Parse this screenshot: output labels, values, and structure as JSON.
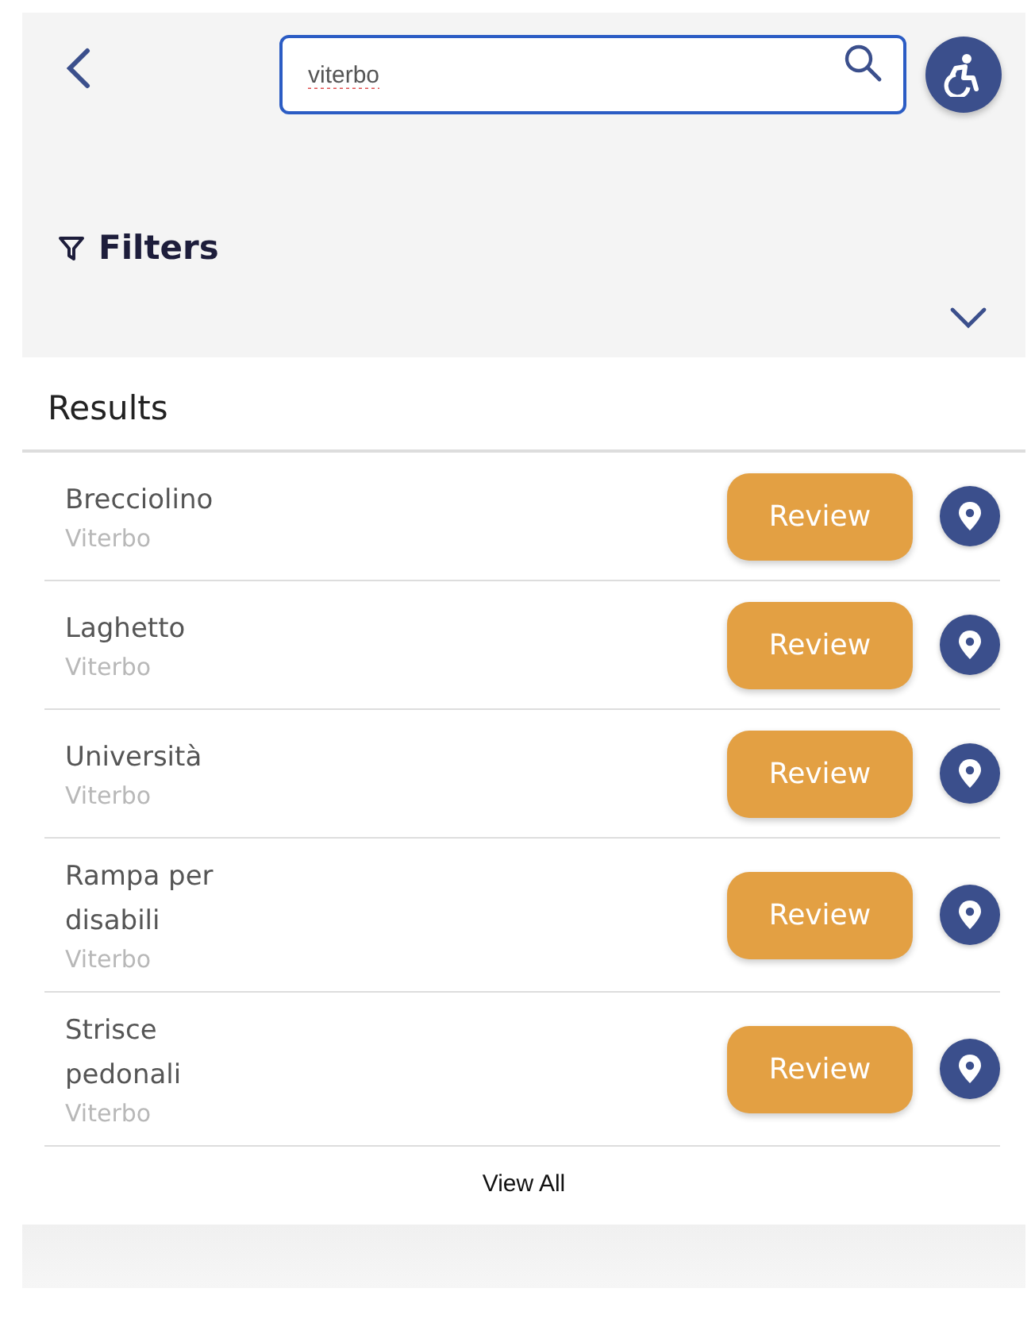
{
  "search": {
    "value": "viterbo"
  },
  "filters": {
    "label": "Filters",
    "expanded": false
  },
  "results": {
    "title": "Results",
    "items": [
      {
        "name": "Brecciolino",
        "city": "Viterbo",
        "button": "Review"
      },
      {
        "name": "Laghetto",
        "city": "Viterbo",
        "button": "Review"
      },
      {
        "name": "Università",
        "city": "Viterbo",
        "button": "Review"
      },
      {
        "name": "Rampa per disabili",
        "city": "Viterbo",
        "button": "Review"
      },
      {
        "name": "Strisce pedonali",
        "city": "Viterbo",
        "button": "Review"
      }
    ],
    "view_all": "View All"
  }
}
